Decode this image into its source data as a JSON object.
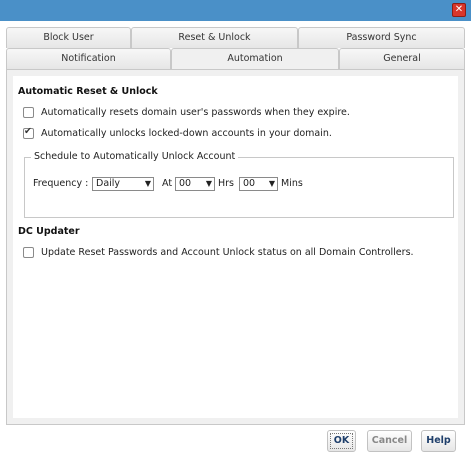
{
  "window": {
    "close_glyph": "✕",
    "title_bar_color": "#4a90c8"
  },
  "tabs": {
    "row1": [
      {
        "label": "Block User",
        "active": false
      },
      {
        "label": "Reset & Unlock",
        "active": false
      },
      {
        "label": "Password Sync",
        "active": false
      }
    ],
    "row2": [
      {
        "label": "Notification",
        "active": false
      },
      {
        "label": "Automation",
        "active": true
      },
      {
        "label": "General",
        "active": false
      }
    ]
  },
  "automatic": {
    "title": "Automatic Reset & Unlock",
    "reset_label": "Automatically resets domain user's passwords when they expire.",
    "reset_checked": false,
    "unlock_label": "Automatically unlocks locked-down accounts in your domain.",
    "unlock_checked": true,
    "schedule": {
      "legend": "Schedule to Automatically Unlock Account",
      "frequency_label": "Frequency :",
      "frequency_value": "Daily",
      "at_label": "At",
      "hours_value": "00",
      "hrs_label": "Hrs",
      "mins_value": "00",
      "mins_label": "Mins"
    }
  },
  "dc_updater": {
    "title": "DC Updater",
    "update_label": "Update Reset Passwords and Account Unlock status on all Domain Controllers.",
    "update_checked": false
  },
  "buttons": {
    "ok": "OK",
    "cancel": "Cancel",
    "help": "Help"
  },
  "icons": {
    "close": "close-icon",
    "dropdown": "chevron-down-icon",
    "checkbox": "checkbox-icon"
  }
}
